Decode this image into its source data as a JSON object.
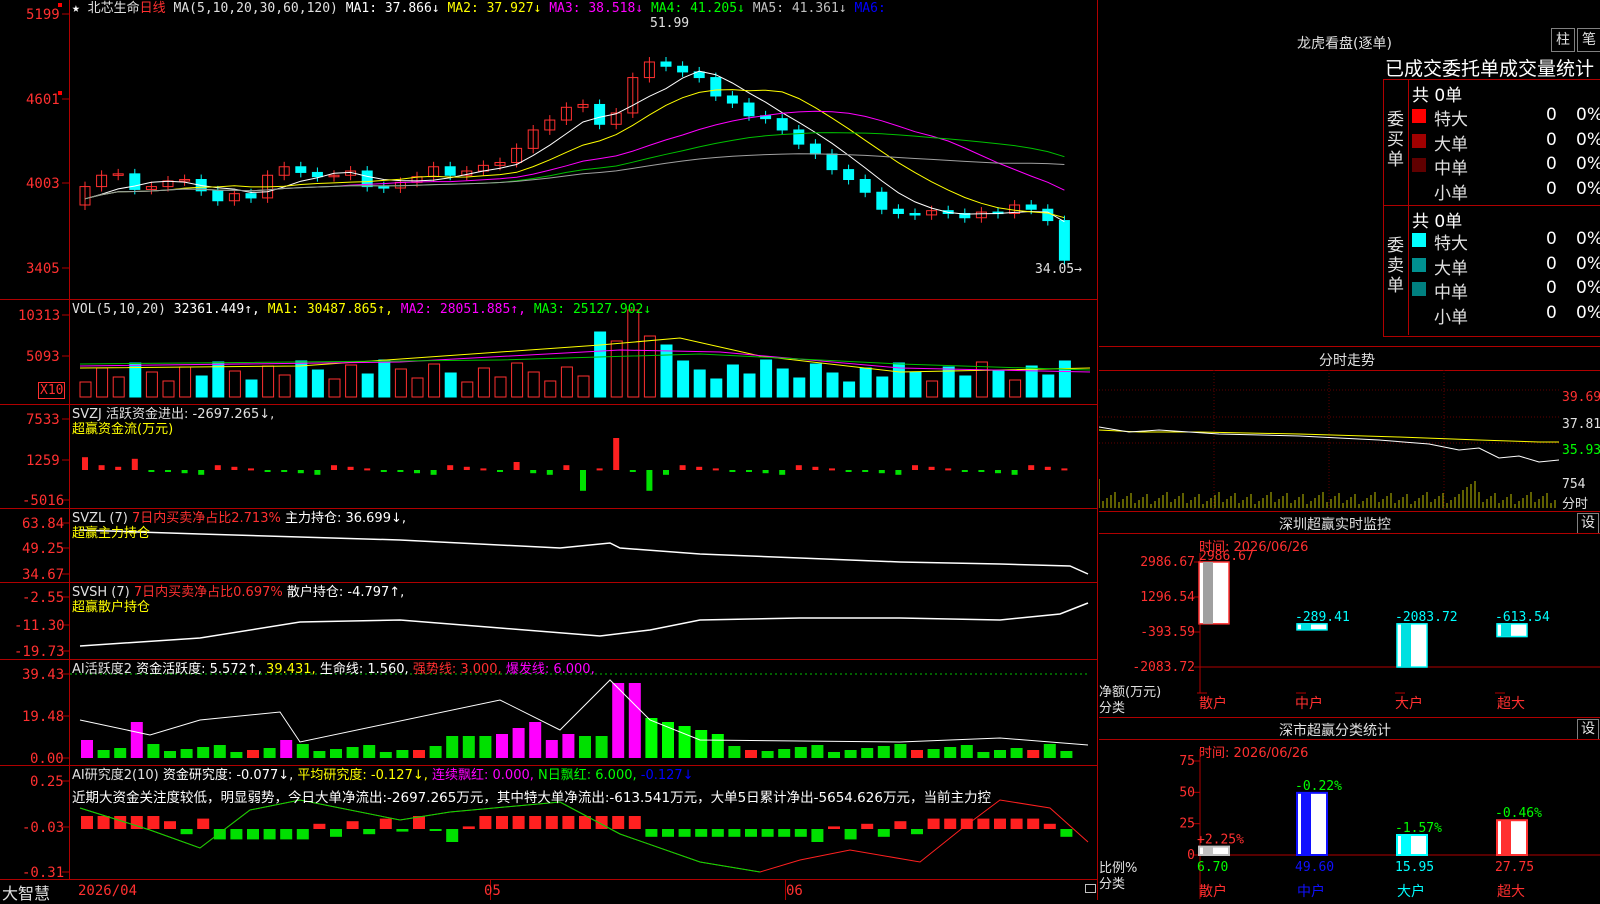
{
  "main": {
    "star": "★",
    "stock_name": "北芯生命",
    "period": "日线",
    "ma_header": "MA(5,10,20,30,60,120)",
    "ma1": "MA1: 37.866↓",
    "ma2": "MA2: 37.927↓",
    "ma3": "MA3: 38.518↓",
    "ma4": "MA4: 41.205↓",
    "ma5": "MA5: 41.361↓",
    "ma6": "MA6:",
    "high_label": "51.99",
    "low_label": "34.05→",
    "y_labels": [
      "5199",
      "4601",
      "4003",
      "3405"
    ]
  },
  "vol": {
    "header": "VOL(5,10,20)",
    "v": "32361.449↑",
    "ma1": "MA1: 30487.865↑",
    "ma2": "MA2: 28051.885↑",
    "ma3": "MA3: 25127.902↓",
    "y_labels": [
      "10313",
      "5093"
    ],
    "unit": "X10"
  },
  "svzj": {
    "header": "SVZJ  活跃资金进出: -2697.265↓,",
    "sub": "超赢资金流(万元)",
    "y_labels": [
      "7533",
      "1259",
      "-5016"
    ]
  },
  "svzl": {
    "name": "SVZL (7)",
    "ratio": "7日内买卖净占比2.713%",
    "hold": "主力持仓: 36.699↓,",
    "sub": "超赢主力持仓",
    "y_labels": [
      "63.84",
      "49.25",
      "34.67"
    ]
  },
  "svsh": {
    "name": "SVSH (7)",
    "ratio": "7日内买卖净占比0.697%",
    "hold": "散户持仓: -4.797↑,",
    "sub": "超赢散户持仓",
    "y_labels": [
      "-2.55",
      "-11.30",
      "-19.73"
    ]
  },
  "ai2": {
    "name": "AI活跃度2",
    "a": "资金活跃度: 5.572↑,",
    "b": "39.431,",
    "c": "生命线: 1.560,",
    "d": "强势线: 3.000,",
    "e": "爆发线: 6.000,",
    "y_labels": [
      "39.43",
      "19.48",
      "0.00"
    ]
  },
  "ai_research": {
    "name": "AI研究度2(10)",
    "a": "资金研究度: -0.077↓,",
    "b": "平均研究度: -0.127↓,",
    "c": "连续飘红: 0.000,",
    "d": "N日飘红: 6.000,",
    "e": "-0.127↓",
    "comment": "近期大资金关注度较低，明显弱势，今日大单净流出:-2697.265万元，其中特大单净流出:-613.541万元，大单5日累计净出-5654.626万元，当前主力控",
    "y_labels": [
      "0.25",
      "-0.03",
      "-0.31"
    ]
  },
  "x_axis": {
    "brand": "大智慧",
    "dates": [
      "2026/04",
      "05",
      "06"
    ]
  },
  "right": {
    "dragon_title": "龙虎看盘(逐单)",
    "btn_bar": "柱",
    "btn_pen": "笔",
    "stat_title": "已成交委托单成交量统计",
    "buy_label": "委买单",
    "sell_label": "委卖单",
    "buy_total": "共 0单",
    "sell_total": "共 0单",
    "buy_rows": [
      {
        "name": "特大",
        "count": "0",
        "pct": "0%",
        "color": "#ff0000"
      },
      {
        "name": "大单",
        "count": "0",
        "pct": "0%",
        "color": "#a00000"
      },
      {
        "name": "中单",
        "count": "0",
        "pct": "0%",
        "color": "#600000"
      },
      {
        "name": "小单",
        "count": "0",
        "pct": "0%",
        "color": "#000000"
      }
    ],
    "sell_rows": [
      {
        "name": "特大",
        "count": "0",
        "pct": "0%",
        "color": "#00ffff"
      },
      {
        "name": "大单",
        "count": "0",
        "pct": "0%",
        "color": "#009090"
      },
      {
        "name": "中单",
        "count": "0",
        "pct": "0%",
        "color": "#008080"
      },
      {
        "name": "小单",
        "count": "0",
        "pct": "0%",
        "color": "#000000"
      }
    ],
    "intraday_title": "分时走势",
    "intraday_y": [
      "39.69",
      "37.81",
      "35.93",
      "754"
    ],
    "intraday_unit": "分时",
    "sz_title": "深圳超赢实时监控",
    "sz_btn": "设",
    "sz_time": "时间: 2026/06/26",
    "sz_y": [
      "2986.67",
      "1296.54",
      "-393.59",
      "-2083.72"
    ],
    "sz_unit1": "净额(万元)",
    "sz_unit2": "分类",
    "sz_bar_labels": [
      "2986.67",
      "-289.41",
      "-2083.72",
      "-613.54"
    ],
    "sz_cats": [
      "散户",
      "中户",
      "大户",
      "超大"
    ],
    "cls_title": "深市超赢分类统计",
    "cls_btn": "设",
    "cls_time": "时间: 2026/06/26",
    "cls_y": [
      "75",
      "50",
      "25",
      "0"
    ],
    "cls_unit1": "比例%",
    "cls_unit2": "分类",
    "cls_top": [
      "+2.25%",
      "-0.22%",
      "-1.57%",
      "-0.46%"
    ],
    "cls_bottom": [
      "6.70",
      "49.60",
      "15.95",
      "27.75"
    ],
    "cls_values": [
      6.7,
      49.6,
      15.95,
      27.75
    ],
    "cls_cats": [
      "散户",
      "中户",
      "大户",
      "超大"
    ]
  },
  "chart_data": [
    {
      "type": "bar",
      "title": "深圳超赢实时监控",
      "categories": [
        "散户",
        "中户",
        "大户",
        "超大"
      ],
      "values": [
        2986.67,
        -289.41,
        -2083.72,
        -613.54
      ],
      "ylabel": "净额(万元)",
      "ylim": [
        -2083.72,
        2986.67
      ]
    },
    {
      "type": "bar",
      "title": "深市超赢分类统计",
      "categories": [
        "散户",
        "中户",
        "大户",
        "超大"
      ],
      "values": [
        6.7,
        49.6,
        15.95,
        27.75
      ],
      "ylabel": "比例%",
      "ylim": [
        0,
        75
      ]
    }
  ]
}
